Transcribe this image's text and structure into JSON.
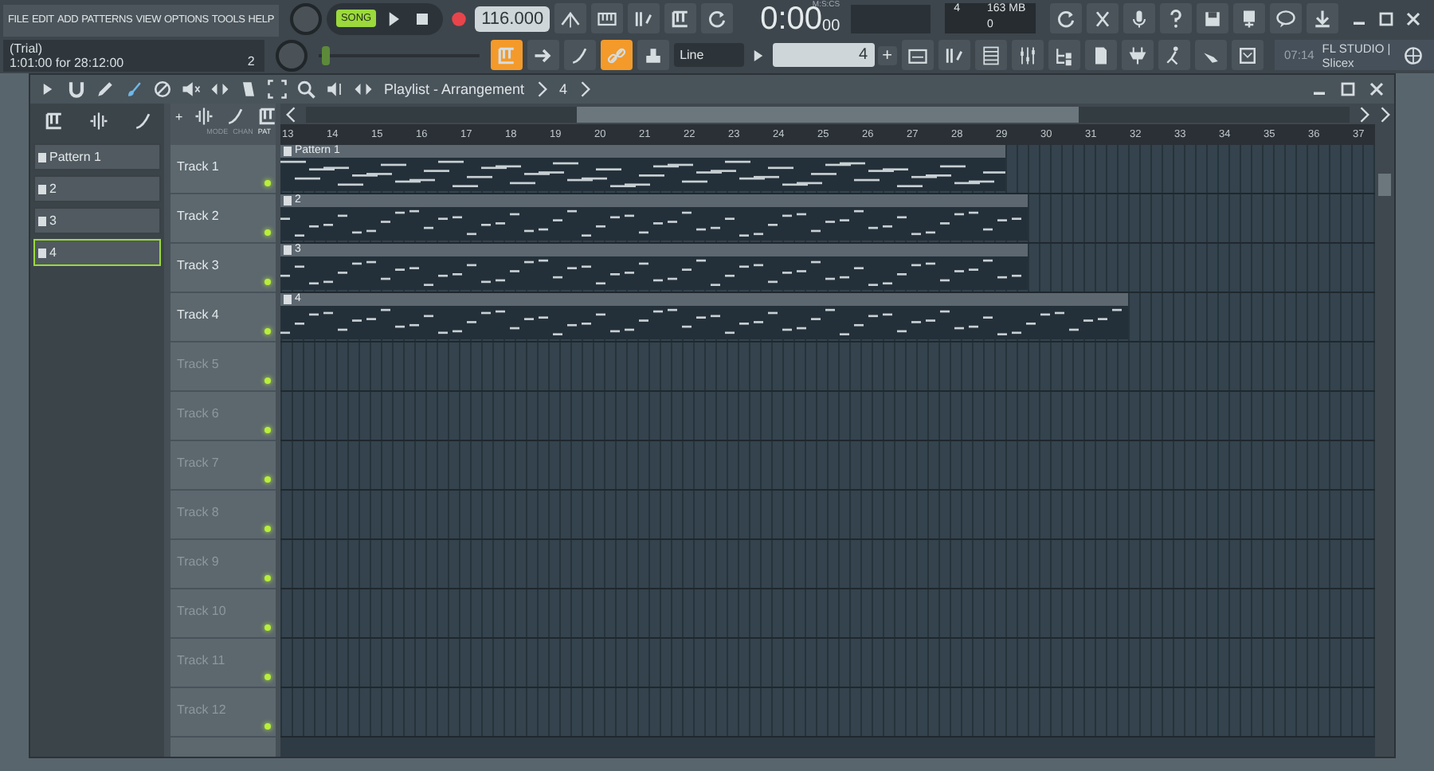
{
  "menu": [
    "FILE",
    "EDIT",
    "ADD",
    "PATTERNS",
    "VIEW",
    "OPTIONS",
    "TOOLS",
    "HELP"
  ],
  "hint_panel": {
    "line_1": "(Trial)",
    "line_2": "1:01:00 for 28:12:00",
    "count": "2"
  },
  "transport": {
    "mode": {
      "label": "SONG",
      "selected": true
    },
    "tempo": "116.000"
  },
  "pitch_slider": {
    "level": 0.02
  },
  "clock": {
    "unit": "M:S:CS",
    "time": "0:00",
    "centis": "00"
  },
  "cpu": {
    "voices": "4",
    "memory": "163 MB",
    "polyphony": "0"
  },
  "toggles": [
    {
      "on": true
    },
    {
      "on": false
    },
    {
      "on": false
    },
    {
      "on": true
    },
    {
      "on": false
    }
  ],
  "snap": {
    "value": "Line"
  },
  "pattern_selector": {
    "value": "4",
    "add": "+"
  },
  "news": {
    "time": "07:14",
    "text": "FL STUDIO | Slicex"
  },
  "playlist": {
    "title": "Playlist - Arrangement",
    "breadcrumb": "4",
    "picker_add": "+",
    "picker_tabs": [
      {
        "label": "MODE",
        "selected": false
      },
      {
        "label": "CHAN",
        "selected": false
      },
      {
        "label": "PAT",
        "selected": true
      }
    ],
    "patterns": [
      {
        "name": "Pattern 1",
        "selected": false
      },
      {
        "name": "2",
        "selected": false
      },
      {
        "name": "3",
        "selected": false
      },
      {
        "name": "4",
        "selected": true
      }
    ],
    "ruler": [
      "13",
      "14",
      "15",
      "16",
      "17",
      "18",
      "19",
      "20",
      "21",
      "22",
      "23",
      "24",
      "25",
      "26",
      "27",
      "28",
      "29",
      "30",
      "31",
      "32",
      "33",
      "34",
      "35",
      "36",
      "37"
    ],
    "tracks": [
      {
        "name": "Track 1",
        "muted": false,
        "clip": {
          "label": "Pattern 1"
        }
      },
      {
        "name": "Track 2",
        "muted": false,
        "clip": {
          "label": "2"
        }
      },
      {
        "name": "Track 3",
        "muted": false,
        "clip": {
          "label": "3"
        }
      },
      {
        "name": "Track 4",
        "muted": false,
        "clip": {
          "label": "4"
        }
      },
      {
        "name": "Track 5",
        "muted": false
      },
      {
        "name": "Track 6",
        "muted": false
      },
      {
        "name": "Track 7",
        "muted": false
      },
      {
        "name": "Track 8",
        "muted": false
      },
      {
        "name": "Track 9",
        "muted": false
      },
      {
        "name": "Track 10",
        "muted": false
      },
      {
        "name": "Track 11",
        "muted": false
      },
      {
        "name": "Track 12",
        "muted": false
      }
    ]
  }
}
